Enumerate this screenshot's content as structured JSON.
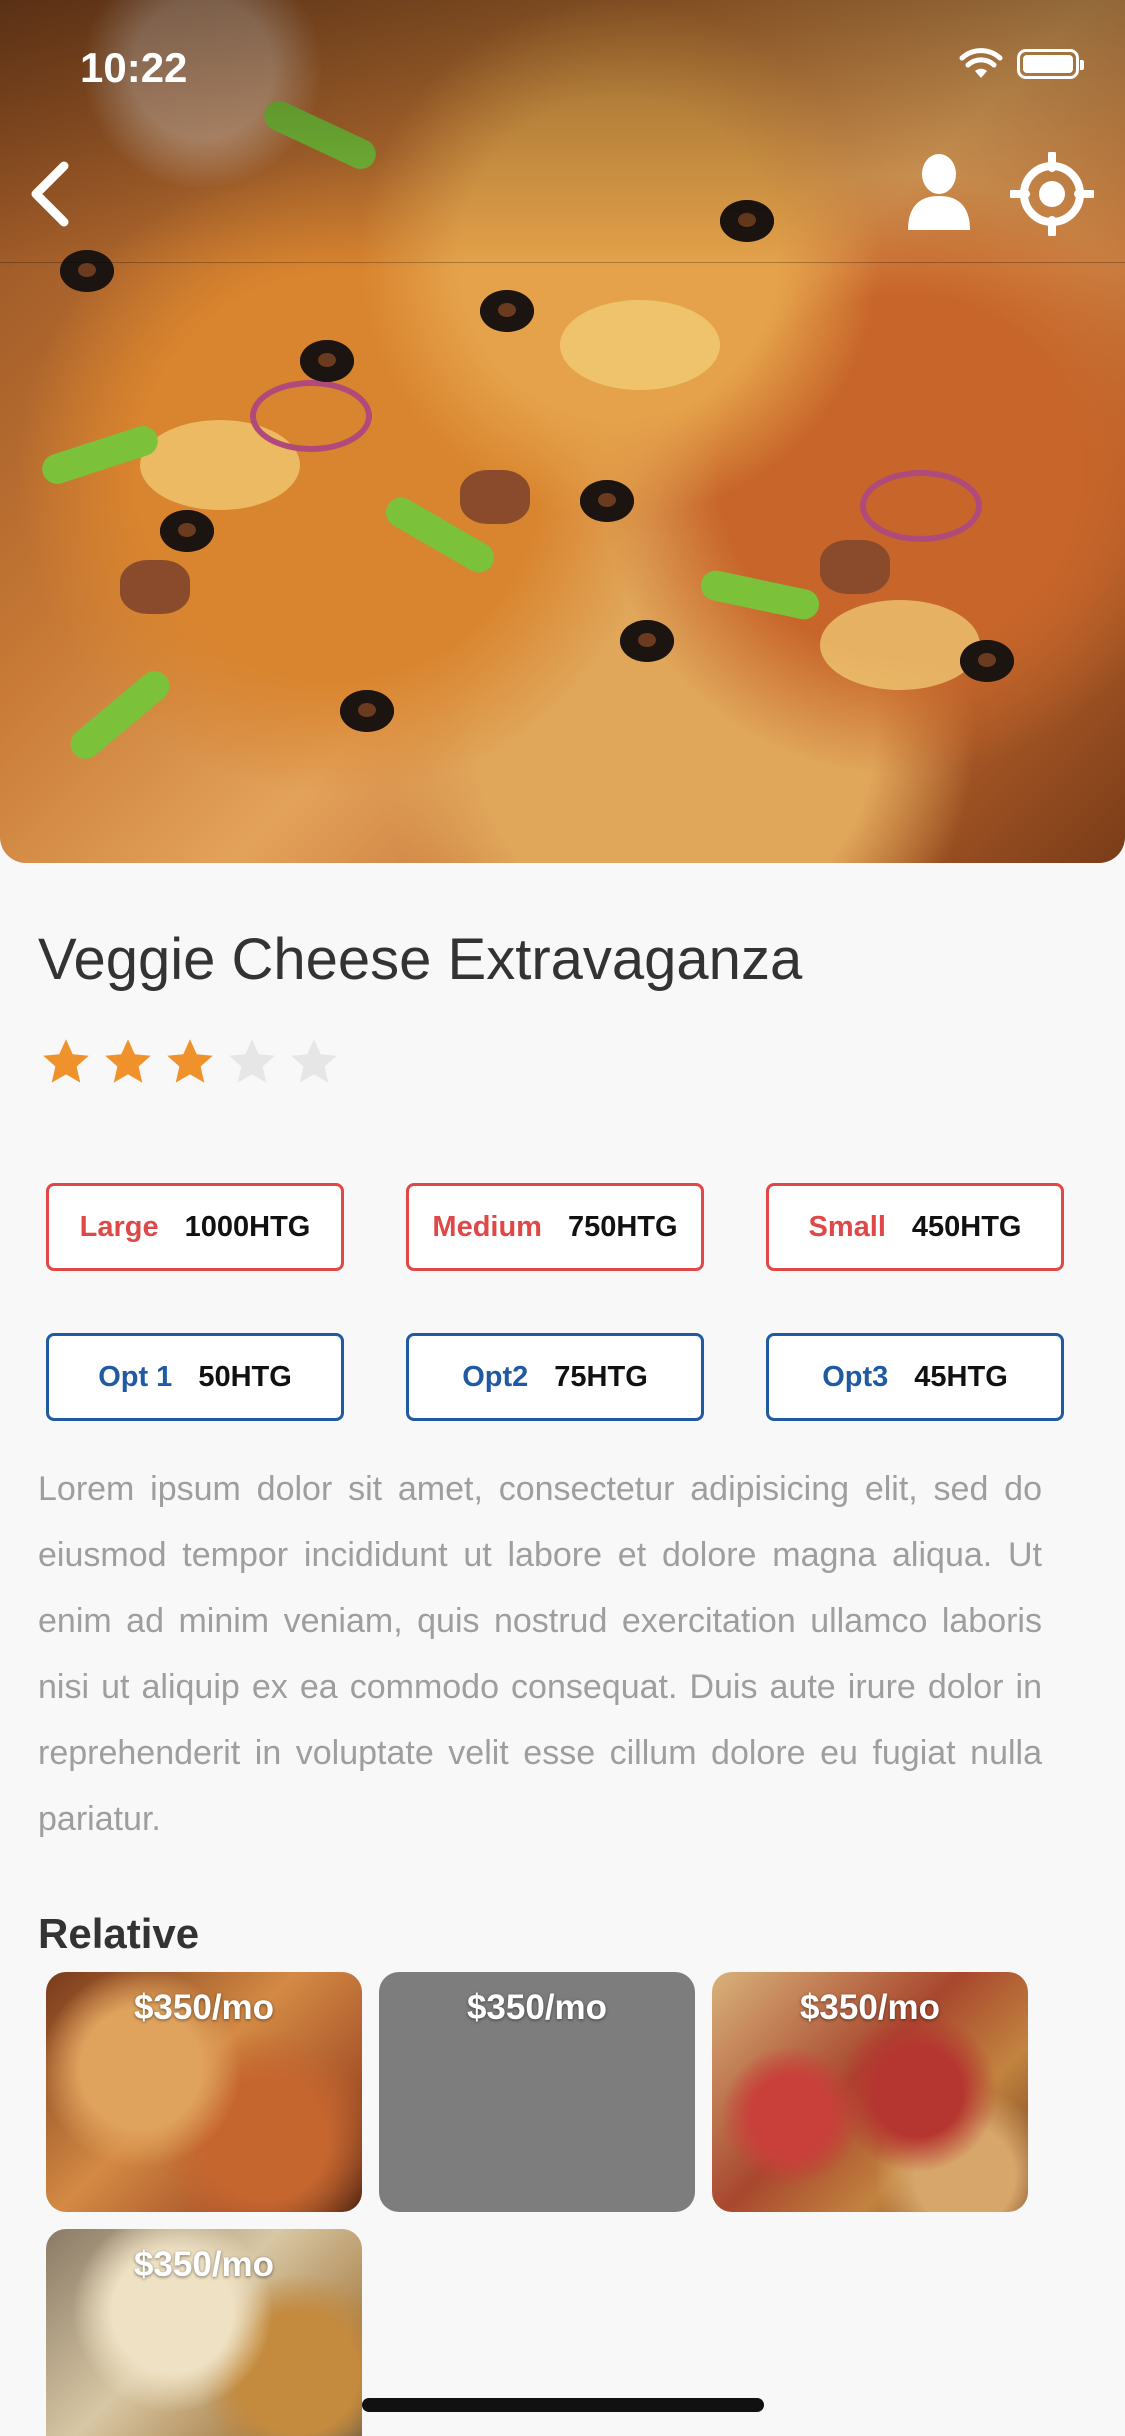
{
  "status_bar": {
    "time": "10:22"
  },
  "product": {
    "name": "Veggie Cheese Extravaganza",
    "rating": 3,
    "rating_max": 5,
    "sizes": [
      {
        "name": "Large",
        "price": "1000HTG"
      },
      {
        "name": "Medium",
        "price": "750HTG"
      },
      {
        "name": "Small",
        "price": "450HTG"
      }
    ],
    "options": [
      {
        "name": "Opt 1",
        "price": "50HTG"
      },
      {
        "name": "Opt2",
        "price": "75HTG"
      },
      {
        "name": "Opt3",
        "price": "45HTG"
      }
    ],
    "description": "Lorem ipsum dolor sit amet, consectetur adipisicing elit, sed do eiusmod tempor incididunt ut labore et dolore magna aliqua. Ut enim ad minim veniam, quis nostrud exercitation ullamco laboris nisi ut aliquip ex ea commodo consequat. Duis aute irure dolor in reprehenderit in voluptate velit esse cillum dolore eu fugiat nulla pariatur."
  },
  "related": {
    "title": "Relative",
    "items": [
      {
        "price": "$350/mo"
      },
      {
        "price": "$350/mo"
      },
      {
        "price": "$350/mo"
      },
      {
        "price": "$350/mo"
      }
    ]
  },
  "icons": {
    "back": "chevron-left-icon",
    "profile": "user-icon",
    "locate": "crosshair-icon",
    "wifi": "wifi-icon",
    "battery": "battery-icon",
    "star": "star-icon"
  },
  "colors": {
    "size_accent": "#e04848",
    "option_accent": "#1f5aa3",
    "star_filled": "#f0922b",
    "star_empty": "#e6e6e6"
  }
}
